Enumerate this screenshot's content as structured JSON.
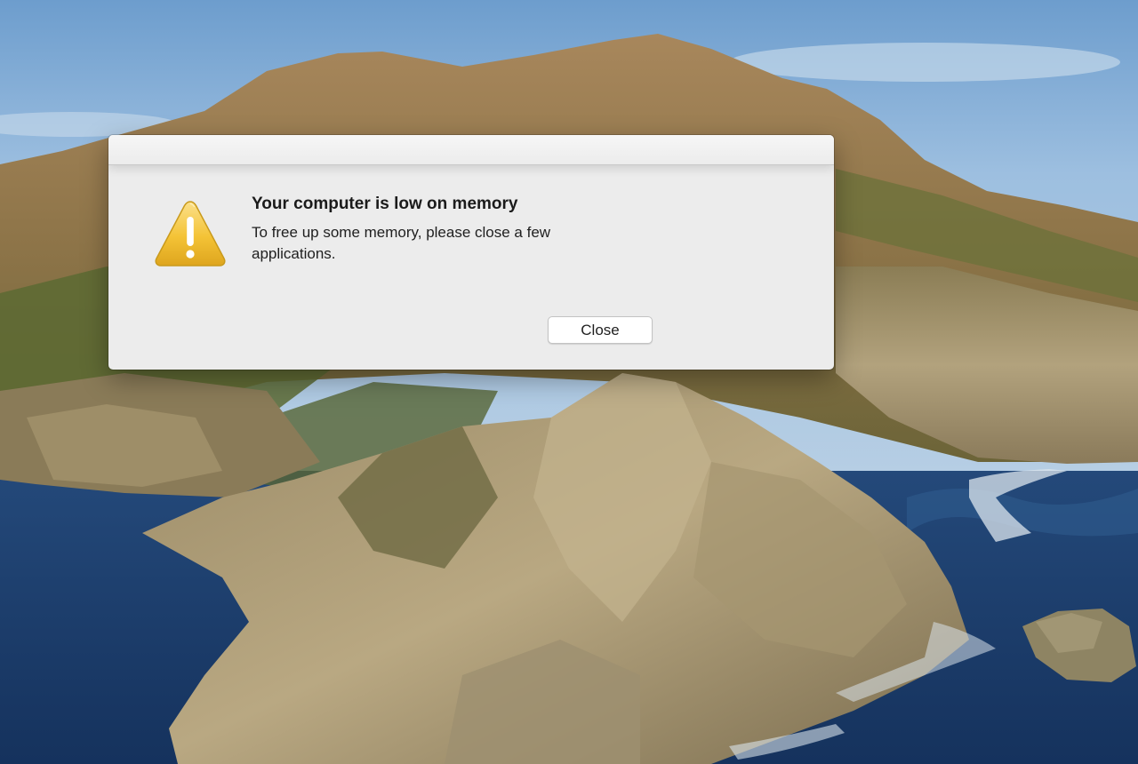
{
  "alert": {
    "title": "Your computer is low on memory",
    "message": "To free up some memory, please close a few applications.",
    "close_label": "Close",
    "icon": "warning-icon"
  },
  "colors": {
    "sky": "#8fb4da",
    "sea": "#1d3f6e",
    "dialog": "#ececec",
    "warning": "#f2c230"
  }
}
